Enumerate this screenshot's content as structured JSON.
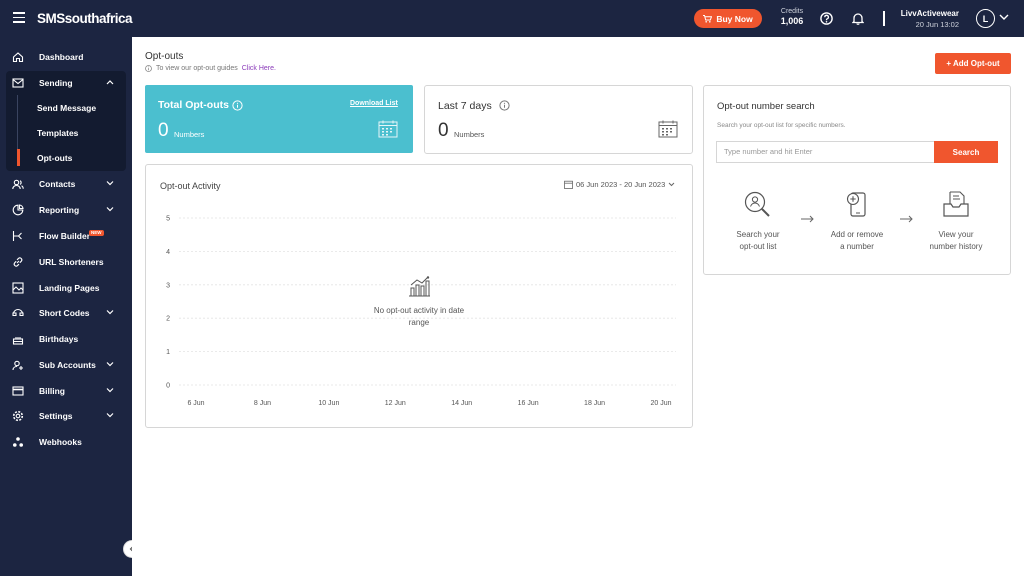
{
  "topbar": {
    "brand": "SMSsouthafrica",
    "buy_now": "Buy Now",
    "credits_label": "Credits",
    "credits_value": "1,006",
    "user_name": "LivvActivewear",
    "datetime": "20 Jun 13:02",
    "avatar_initial": "L"
  },
  "sidebar": {
    "items": [
      {
        "label": "Dashboard",
        "icon": "home-icon"
      },
      {
        "label": "Sending",
        "icon": "mail-icon"
      },
      {
        "label": "Contacts",
        "icon": "contacts-icon"
      },
      {
        "label": "Reporting",
        "icon": "pie-chart-icon"
      },
      {
        "label": "Flow Builder",
        "icon": "flow-icon",
        "badge": "NEW"
      },
      {
        "label": "URL Shorteners",
        "icon": "link-icon"
      },
      {
        "label": "Landing Pages",
        "icon": "landing-page-icon"
      },
      {
        "label": "Short Codes",
        "icon": "phone-icon"
      },
      {
        "label": "Birthdays",
        "icon": "cake-icon"
      },
      {
        "label": "Sub Accounts",
        "icon": "users-icon"
      },
      {
        "label": "Billing",
        "icon": "card-icon"
      },
      {
        "label": "Settings",
        "icon": "gear-icon"
      },
      {
        "label": "Webhooks",
        "icon": "webhook-icon"
      }
    ],
    "sending_subitems": [
      "Send Message",
      "Templates",
      "Opt-outs"
    ],
    "active_item": "Opt-outs"
  },
  "page": {
    "title": "Opt-outs",
    "info_text": "To view our opt-out guides",
    "info_link": "Click Here.",
    "add_button": "+ Add Opt-out"
  },
  "total_card": {
    "title": "Total Opt-outs",
    "download": "Download List",
    "value": "0",
    "unit": "Numbers"
  },
  "last7_card": {
    "title": "Last 7 days",
    "value": "0",
    "unit": "Numbers"
  },
  "activity": {
    "title": "Opt-out Activity",
    "date_range": "06 Jun 2023 - 20 Jun 2023",
    "empty_line1": "No opt-out activity in date",
    "empty_line2": "range"
  },
  "chart_data": {
    "type": "line",
    "title": "Opt-out Activity",
    "x": [
      "6 Jun",
      "8 Jun",
      "10 Jun",
      "12 Jun",
      "14 Jun",
      "16 Jun",
      "18 Jun",
      "20 Jun"
    ],
    "y_ticks": [
      "0",
      "1",
      "2",
      "3",
      "4",
      "5"
    ],
    "ylim": [
      0,
      5
    ],
    "series": [],
    "grid": true
  },
  "search_panel": {
    "title": "Opt-out number search",
    "subtitle": "Search your opt-out list for specific numbers.",
    "placeholder": "Type number and hit Enter",
    "button": "Search",
    "steps": [
      {
        "line1": "Search your",
        "line2": "opt-out list",
        "icon": "search-person-icon"
      },
      {
        "line1": "Add or remove",
        "line2": "a number",
        "icon": "mobile-add-icon"
      },
      {
        "line1": "View your",
        "line2": "number history",
        "icon": "inbox-history-icon"
      }
    ]
  },
  "colors": {
    "navy": "#1c2541",
    "accent": "#f0562e",
    "teal": "#4bbfcf"
  }
}
